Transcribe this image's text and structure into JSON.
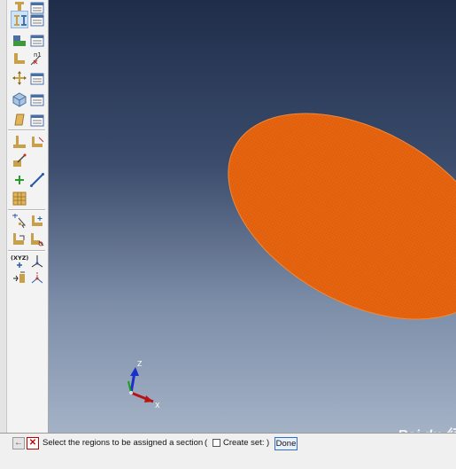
{
  "toolbox": {
    "tools": [
      {
        "name": "create-material-icon"
      },
      {
        "name": "material-manager-icon"
      },
      {
        "name": "create-section-icon"
      },
      {
        "name": "section-manager-icon"
      },
      {
        "name": "assign-section-icon"
      },
      {
        "name": "section-assignment-manager-icon"
      },
      {
        "name": "create-beam-profile-icon"
      },
      {
        "name": "assign-beam-orientation-icon"
      },
      {
        "name": "assign-material-orientation-icon"
      },
      {
        "name": "profile-manager-icon"
      },
      {
        "name": "create-part-icon"
      },
      {
        "name": "part-manager-icon"
      },
      {
        "name": "create-surface-icon"
      },
      {
        "name": "surface-manager-icon"
      },
      {
        "name": "special-tools-icon"
      },
      {
        "name": "skin-tools-icon"
      },
      {
        "name": "display-group-icon"
      },
      {
        "name": "create-datum-point-icon"
      },
      {
        "name": "create-datum-axis-icon"
      },
      {
        "name": "partition-icon"
      },
      {
        "name": "query-tools-icon"
      },
      {
        "name": "assembly-tools-icon"
      },
      {
        "name": "repair-tools-icon"
      },
      {
        "name": "edit-feature-icon"
      },
      {
        "name": "datum-csys-icon"
      },
      {
        "name": "reference-point-icon"
      },
      {
        "name": "transform-icon"
      },
      {
        "name": "delete-feature-icon"
      }
    ]
  },
  "triad": {
    "z_label": "Z",
    "x_label": "X"
  },
  "colors": {
    "part_fill": "#e6640f",
    "viewport_top": "#1f2d4a",
    "viewport_bottom": "#a4b2c6"
  },
  "prompt": {
    "cancel_icon": "arrow-left-icon",
    "message": "Select the regions to be assigned a section",
    "open_paren": "(",
    "create_set_label": "Create set:",
    "close_paren": ")",
    "done_label": "Done"
  },
  "watermark": {
    "text": "Bai du 经验"
  }
}
